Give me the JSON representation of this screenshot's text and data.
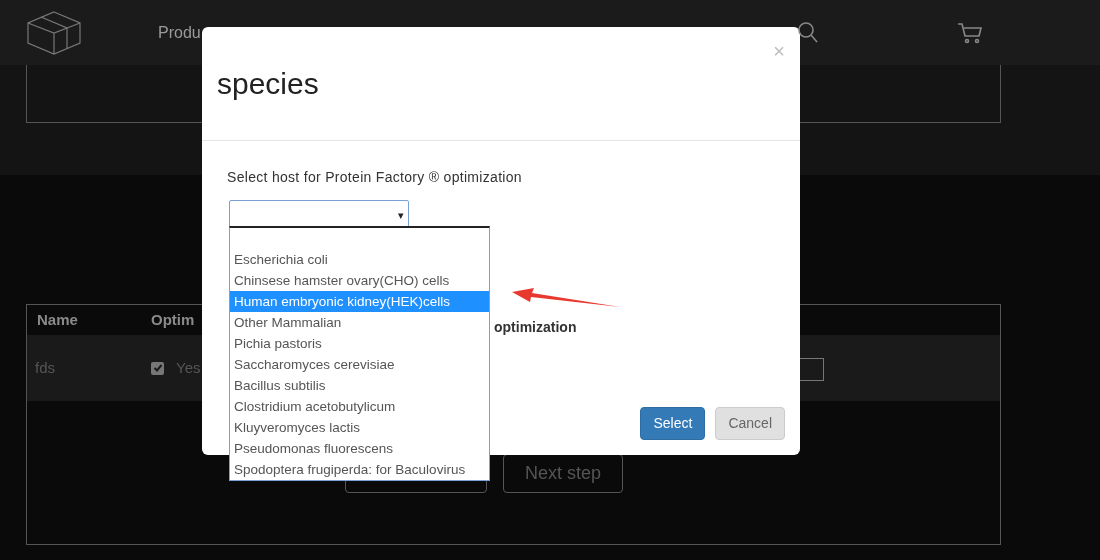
{
  "nav": {
    "items": [
      "Produ"
    ]
  },
  "table": {
    "columns": [
      "Name",
      "Optim"
    ],
    "rows": [
      {
        "name": "fds",
        "checked": true,
        "option": "Yes"
      }
    ]
  },
  "next_button": "Next step",
  "modal": {
    "title": "species",
    "close": "×",
    "label": "Select host for Protein Factory ® optimization",
    "select": {
      "caret": "▾",
      "options": [
        {
          "label": "Escherichia coli",
          "selected": false
        },
        {
          "label": "Chinsese hamster ovary(CHO) cells",
          "selected": false
        },
        {
          "label": "Human embryonic kidney(HEK)cells",
          "selected": true
        },
        {
          "label": "Other Mammalian",
          "selected": false
        },
        {
          "label": "Pichia pastoris",
          "selected": false
        },
        {
          "label": "Saccharomyces cerevisiae",
          "selected": false
        },
        {
          "label": "Bacillus subtilis",
          "selected": false
        },
        {
          "label": "Clostridium acetobutylicum",
          "selected": false
        },
        {
          "label": "Kluyveromyces lactis",
          "selected": false
        },
        {
          "label": "Pseudomonas fluorescens",
          "selected": false
        },
        {
          "label": "Spodoptera frugiperda: for Baculovirus",
          "selected": false
        }
      ]
    },
    "partial_text": "optimization",
    "buttons": [
      {
        "label": "Select",
        "kind": "primary"
      },
      {
        "label": "Cancel",
        "kind": "default"
      }
    ]
  }
}
